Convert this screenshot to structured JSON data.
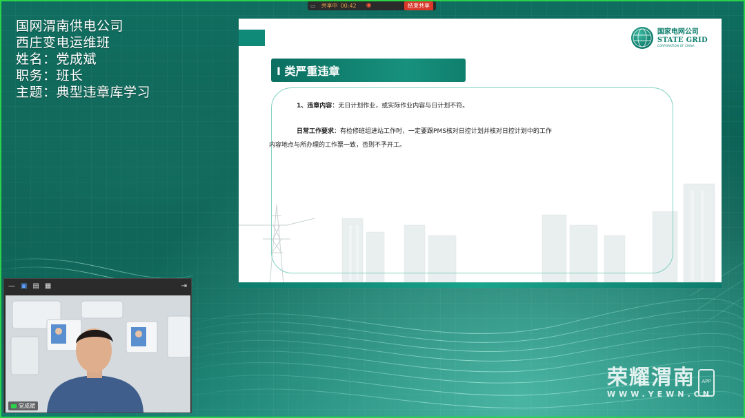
{
  "share_bar": {
    "status": "共享中",
    "time": "00:42",
    "stop_label": "结束共享"
  },
  "info": {
    "line1": "国网渭南供电公司",
    "line2": "西庄变电运维班",
    "line3": "姓名：党成斌",
    "line4": "职务：班长",
    "line5": "主题：典型违章库学习"
  },
  "slide": {
    "logo": {
      "cn": "国家电网公司",
      "en": "STATE GRID",
      "sub": "CORPORATION OF CHINA"
    },
    "title": "I 类严重违章",
    "item1_label": "1、违章内容",
    "item1_text": "：无日计划作业，或实际作业内容与日计划不符。",
    "item2_label": "日常工作要求",
    "item2_text": "：有检修班组进站工作时，一定要跟PMS核对日控计划并核对日控计划中的工作",
    "item2_cont": "内容地点与所办理的工作票一致，否则不予开工。"
  },
  "camera": {
    "name": "党成斌"
  },
  "watermark": {
    "title": "荣耀渭南",
    "url": "WWW.YEWN.CN",
    "app": "APP"
  },
  "colors": {
    "frame": "#2bd34a",
    "brand": "#0f7f6d",
    "stop": "#d8372a"
  }
}
